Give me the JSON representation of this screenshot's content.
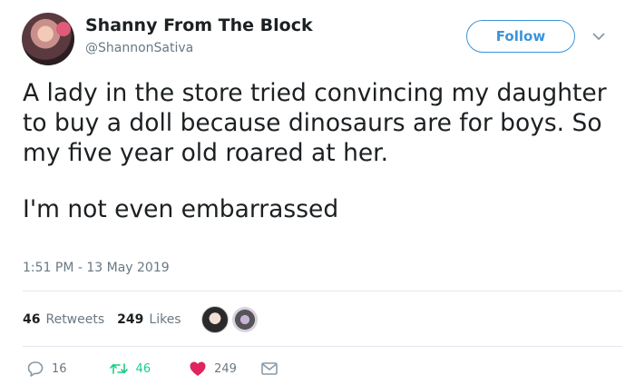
{
  "author": {
    "name": "Shanny From The Block",
    "handle": "@ShannonSativa"
  },
  "follow_button": {
    "label": "Follow"
  },
  "tweet": {
    "paragraphs": [
      "A lady in the store tried convincing my daughter to buy a doll because dinosaurs are for boys. So my five year old roared at her.",
      "I'm not even embarrassed"
    ],
    "timestamp": "1:51 PM - 13 May 2019"
  },
  "stats": {
    "retweets_count": "46",
    "retweets_label": "Retweets",
    "likes_count": "249",
    "likes_label": "Likes"
  },
  "actions": {
    "reply_count": "16",
    "retweet_count": "46",
    "like_count": "249"
  },
  "icons": {
    "reply": "reply-icon",
    "retweet": "retweet-icon",
    "like": "heart-icon",
    "message": "envelope-icon",
    "more": "chevron-down-icon"
  },
  "colors": {
    "accent": "#3b94d9",
    "retweet": "#19cf86",
    "like": "#e0245e",
    "muted": "#697882",
    "text": "#1c2022"
  }
}
